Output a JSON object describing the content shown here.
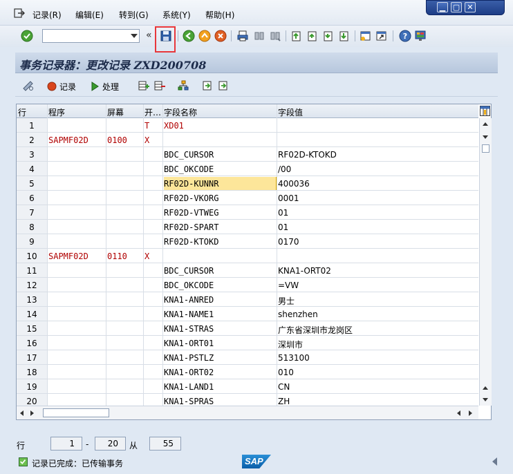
{
  "menu": [
    "记录(R)",
    "编辑(E)",
    "转到(G)",
    "系统(Y)",
    "帮助(H)"
  ],
  "window_controls": {
    "minimize": "▁",
    "maximize": "▢",
    "close": "✕"
  },
  "toolbar": {
    "command_value": "",
    "nav_arrows": "«"
  },
  "title": "事务记录器：更改记录 ZXD200708",
  "app_toolbar": {
    "record": "记录",
    "process": "处理"
  },
  "table": {
    "headers": [
      "行",
      "程序",
      "屏幕",
      "开…",
      "字段名称",
      "字段值"
    ],
    "rows": [
      {
        "n": "1",
        "prog": "",
        "screen": "",
        "flag": "T",
        "field": "XD01",
        "value": ""
      },
      {
        "n": "2",
        "prog": "SAPMF02D",
        "screen": "0100",
        "flag": "X",
        "field": "",
        "value": ""
      },
      {
        "n": "3",
        "prog": "",
        "screen": "",
        "flag": "",
        "field": "BDC_CURSOR",
        "value": "RF02D-KTOKD"
      },
      {
        "n": "4",
        "prog": "",
        "screen": "",
        "flag": "",
        "field": "BDC_OKCODE",
        "value": "/00"
      },
      {
        "n": "5",
        "prog": "",
        "screen": "",
        "flag": "",
        "field": "RF02D-KUNNR",
        "value": "400036"
      },
      {
        "n": "6",
        "prog": "",
        "screen": "",
        "flag": "",
        "field": "RF02D-VKORG",
        "value": "0001"
      },
      {
        "n": "7",
        "prog": "",
        "screen": "",
        "flag": "",
        "field": "RF02D-VTWEG",
        "value": "01"
      },
      {
        "n": "8",
        "prog": "",
        "screen": "",
        "flag": "",
        "field": "RF02D-SPART",
        "value": "01"
      },
      {
        "n": "9",
        "prog": "",
        "screen": "",
        "flag": "",
        "field": "RF02D-KTOKD",
        "value": "0170"
      },
      {
        "n": "10",
        "prog": "SAPMF02D",
        "screen": "0110",
        "flag": "X",
        "field": "",
        "value": ""
      },
      {
        "n": "11",
        "prog": "",
        "screen": "",
        "flag": "",
        "field": "BDC_CURSOR",
        "value": "KNA1-ORT02"
      },
      {
        "n": "12",
        "prog": "",
        "screen": "",
        "flag": "",
        "field": "BDC_OKCODE",
        "value": "=VW"
      },
      {
        "n": "13",
        "prog": "",
        "screen": "",
        "flag": "",
        "field": "KNA1-ANRED",
        "value": "男士"
      },
      {
        "n": "14",
        "prog": "",
        "screen": "",
        "flag": "",
        "field": "KNA1-NAME1",
        "value": "shenzhen"
      },
      {
        "n": "15",
        "prog": "",
        "screen": "",
        "flag": "",
        "field": "KNA1-STRAS",
        "value": "广东省深圳市龙岗区"
      },
      {
        "n": "16",
        "prog": "",
        "screen": "",
        "flag": "",
        "field": "KNA1-ORT01",
        "value": "深圳市"
      },
      {
        "n": "17",
        "prog": "",
        "screen": "",
        "flag": "",
        "field": "KNA1-PSTLZ",
        "value": "513100"
      },
      {
        "n": "18",
        "prog": "",
        "screen": "",
        "flag": "",
        "field": "KNA1-ORT02",
        "value": "010"
      },
      {
        "n": "19",
        "prog": "",
        "screen": "",
        "flag": "",
        "field": "KNA1-LAND1",
        "value": "CN"
      },
      {
        "n": "20",
        "prog": "",
        "screen": "",
        "flag": "",
        "field": "KNA1-SPRAS",
        "value": "ZH"
      }
    ]
  },
  "footer": {
    "row_label": "行",
    "from_row": "1",
    "dash": "-",
    "to_row": "20",
    "of_label": "从",
    "total": "55"
  },
  "status": {
    "message": "记录已完成：已传输事务",
    "logo": "SAP"
  },
  "colors": {
    "accent_red": "#e8363a",
    "program_red": "#b00000",
    "selected_cell": "#fde69a"
  }
}
